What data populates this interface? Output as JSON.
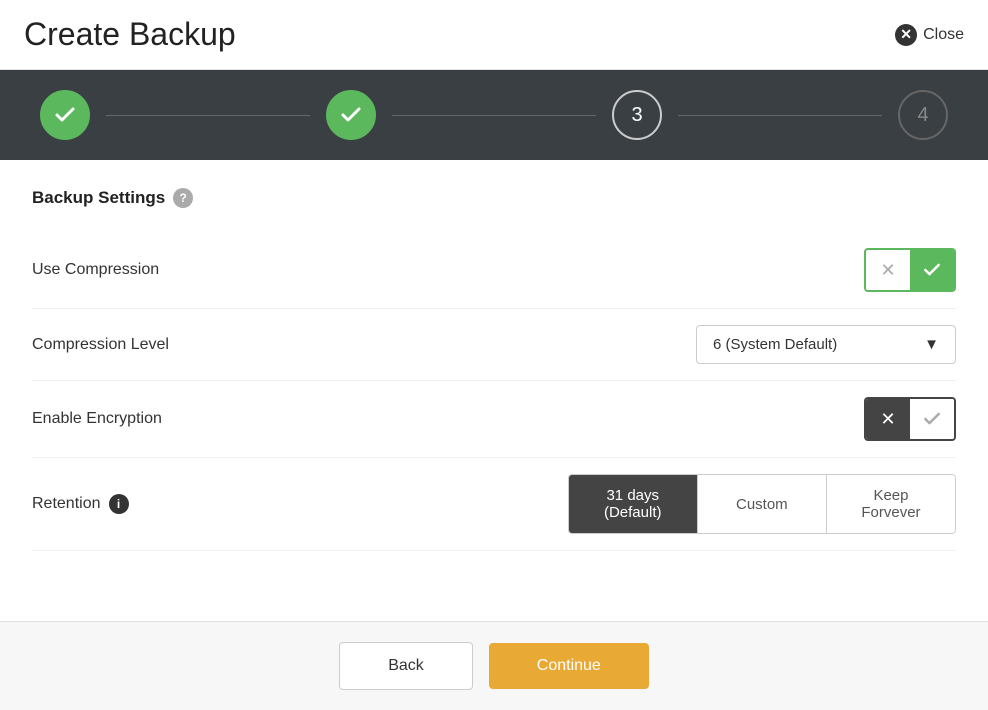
{
  "header": {
    "title": "Create Backup",
    "close_label": "Close"
  },
  "stepper": {
    "steps": [
      {
        "id": 1,
        "label": "✓",
        "state": "completed"
      },
      {
        "id": 2,
        "label": "✓",
        "state": "completed"
      },
      {
        "id": 3,
        "label": "3",
        "state": "active"
      },
      {
        "id": 4,
        "label": "4",
        "state": "inactive"
      }
    ]
  },
  "section": {
    "title": "Backup Settings",
    "help_tooltip": "?"
  },
  "settings": {
    "use_compression": {
      "label": "Use Compression",
      "value": true
    },
    "compression_level": {
      "label": "Compression Level",
      "value": "6 (System Default)"
    },
    "enable_encryption": {
      "label": "Enable Encryption",
      "value": false
    },
    "retention": {
      "label": "Retention",
      "options": [
        {
          "id": "default",
          "label": "31 days (Default)",
          "active": true
        },
        {
          "id": "custom",
          "label": "Custom",
          "active": false
        },
        {
          "id": "forever",
          "label": "Keep Forvever",
          "active": false
        }
      ]
    }
  },
  "footer": {
    "back_label": "Back",
    "continue_label": "Continue"
  }
}
